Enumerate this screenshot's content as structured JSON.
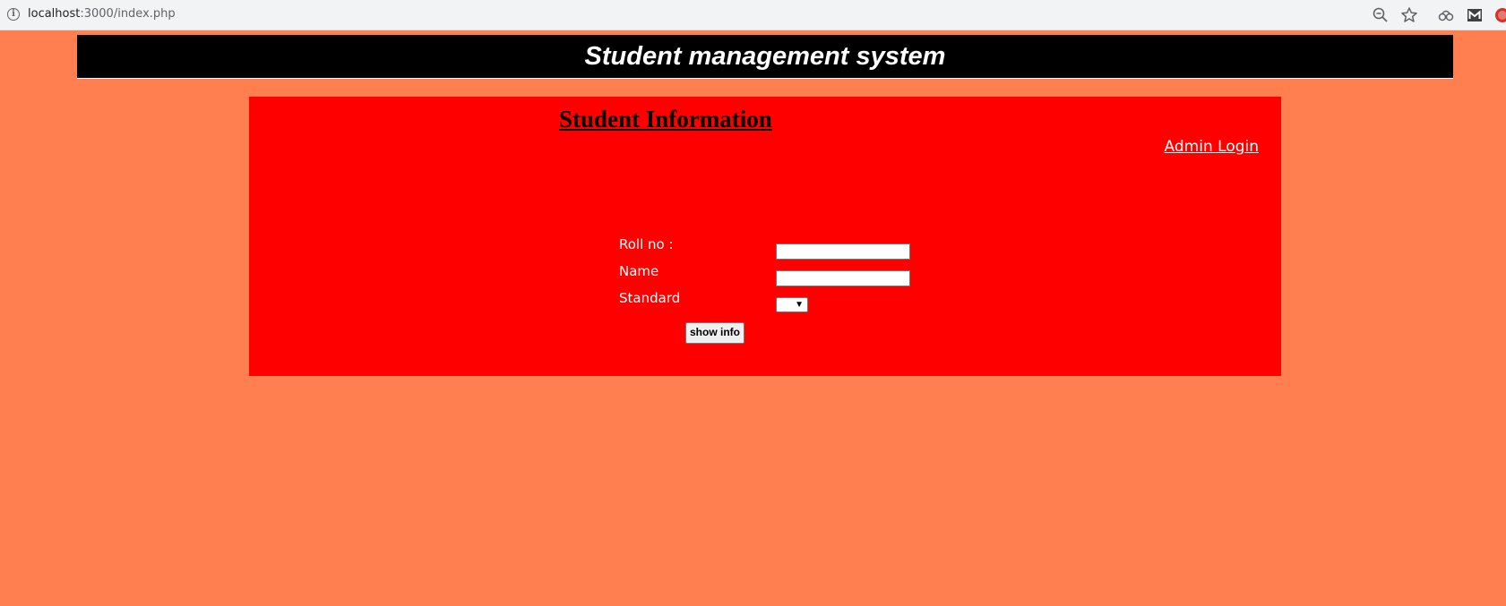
{
  "browser": {
    "url_host": "localhost",
    "url_path": ":3000/index.php",
    "icons": [
      "info-icon",
      "zoom-out-icon",
      "star-icon",
      "extension-icon",
      "gmail-icon",
      "profile-icon"
    ]
  },
  "header": {
    "title": "Student management system"
  },
  "panel": {
    "title": "Student Information",
    "admin_link": "Admin Login"
  },
  "form": {
    "roll_label": "Roll no :",
    "roll_value": "",
    "name_label": "Name",
    "name_value": "",
    "standard_label": "Standard",
    "standard_value": "",
    "submit_label": "show info"
  },
  "colors": {
    "page_bg": "#ff7f50",
    "header_bg": "#000000",
    "panel_bg": "#ff0000",
    "label_text": "#ffffff"
  }
}
